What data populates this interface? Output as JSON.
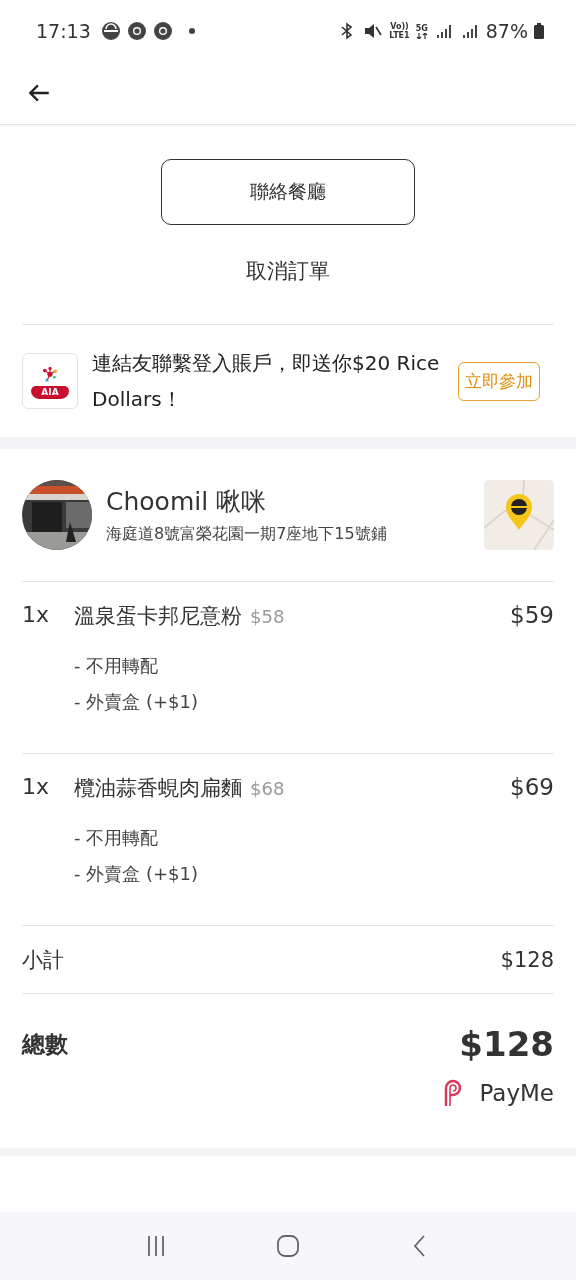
{
  "status_bar": {
    "time": "17:13",
    "volte": "Vo))",
    "lte": "LTE1",
    "network": "5G",
    "battery": "87%"
  },
  "actions": {
    "contact": "聯絡餐廳",
    "cancel": "取消訂單"
  },
  "promo": {
    "text": "連結友聯繫登入賬戶，即送你$20 Rice Dollars！",
    "logo_label": "AIA",
    "button": "立即參加"
  },
  "restaurant": {
    "name": "Choomil 啾咪",
    "address": "海庭道8號富榮花園一期7座地下15號鋪"
  },
  "items": [
    {
      "qty": "1x",
      "name": "溫泉蛋卡邦尼意粉",
      "unit_price": "$58",
      "price": "$59",
      "options": [
        "- 不用轉配",
        "- 外賣盒 (+$1)"
      ]
    },
    {
      "qty": "1x",
      "name": "欖油蒜香蜆肉扁麵",
      "unit_price": "$68",
      "price": "$69",
      "options": [
        "- 不用轉配",
        "- 外賣盒 (+$1)"
      ]
    }
  ],
  "subtotal": {
    "label": "小計",
    "value": "$128"
  },
  "total": {
    "label": "總數",
    "value": "$128",
    "payment": "PayMe"
  }
}
